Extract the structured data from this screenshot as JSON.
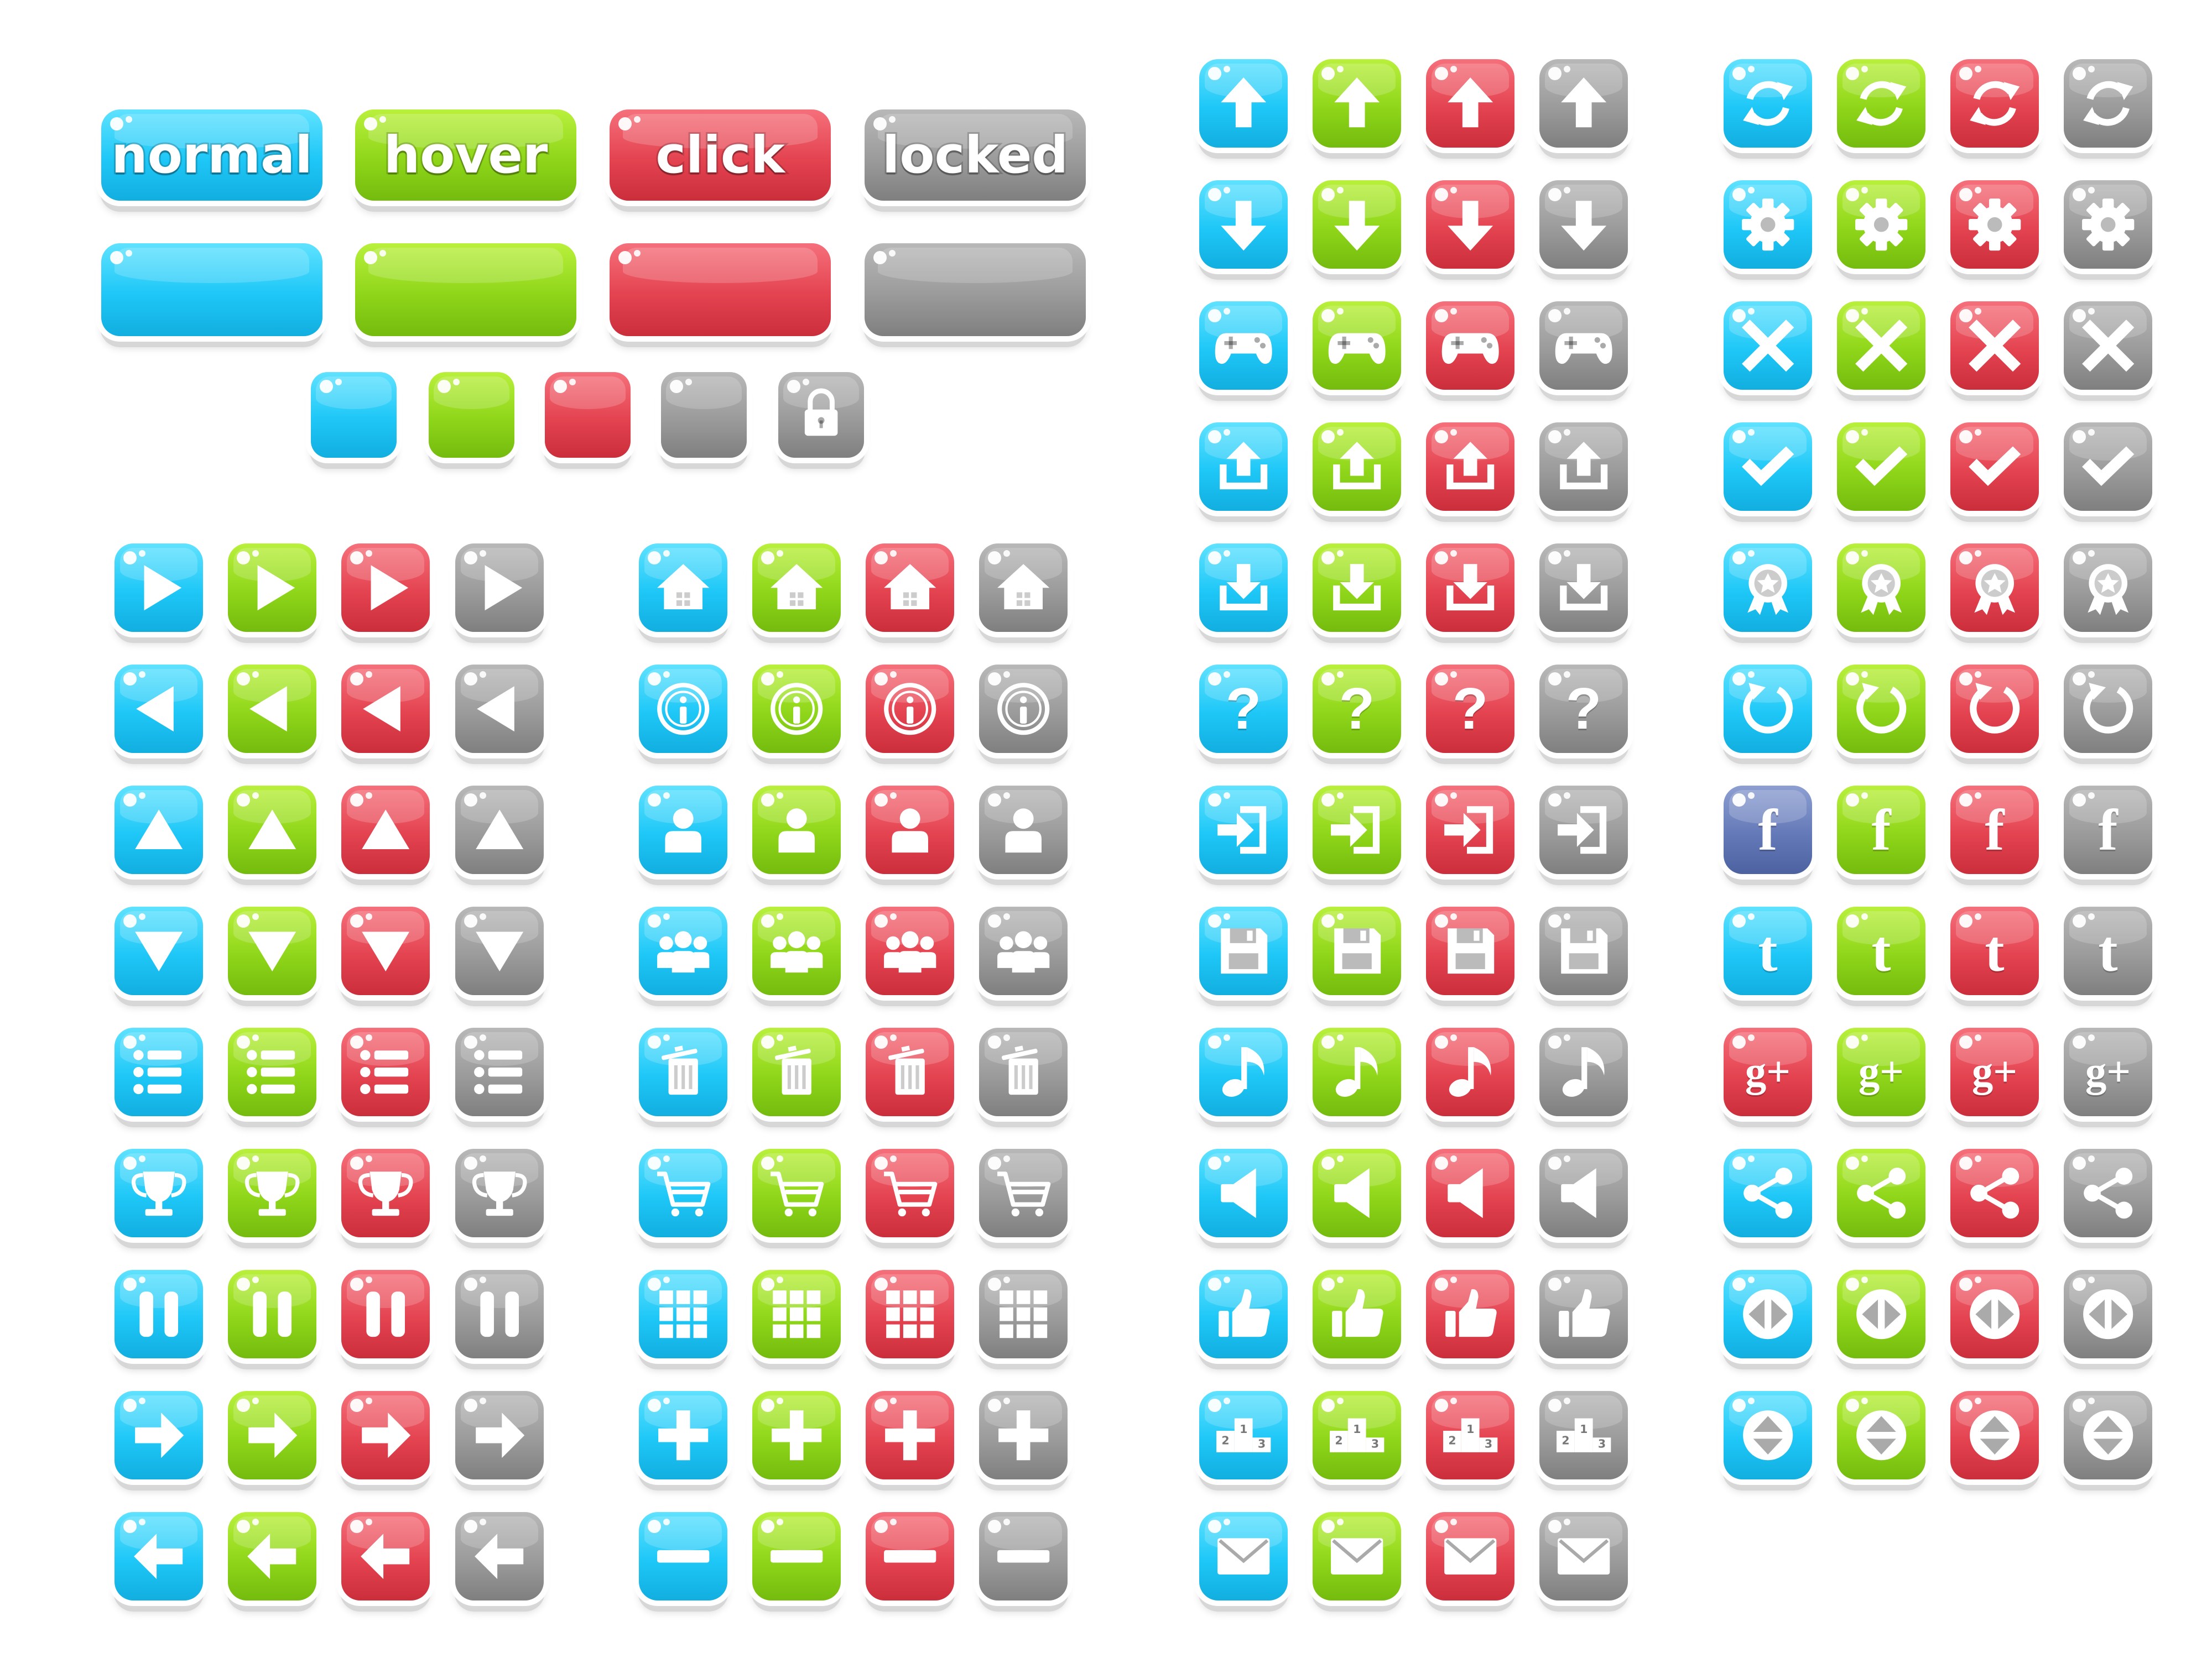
{
  "palette": {
    "blue": {
      "top": "#5fe2ff",
      "mid": "#1ec7f7",
      "bot": "#12aee0"
    },
    "green": {
      "top": "#b9f03c",
      "mid": "#8fd61a",
      "bot": "#74bb0e"
    },
    "red": {
      "top": "#f5707b",
      "mid": "#e44350",
      "bot": "#cb2e3b"
    },
    "gray": {
      "top": "#b8b8b8",
      "mid": "#9b9b9b",
      "bot": "#7f7f7f"
    },
    "fbblue": {
      "top": "#8d9fd1",
      "mid": "#6479b8",
      "bot": "#4d62a0"
    }
  },
  "state_colors": [
    "blue",
    "green",
    "red",
    "gray"
  ],
  "text_buttons": [
    {
      "label": "normal",
      "color": "blue"
    },
    {
      "label": "hover",
      "color": "green"
    },
    {
      "label": "click",
      "color": "red"
    },
    {
      "label": "locked",
      "color": "gray"
    }
  ],
  "blank_wide_buttons": [
    "blue",
    "green",
    "red",
    "gray"
  ],
  "small_squares": [
    {
      "color": "blue",
      "icon": ""
    },
    {
      "color": "green",
      "icon": ""
    },
    {
      "color": "red",
      "icon": ""
    },
    {
      "color": "gray",
      "icon": ""
    },
    {
      "color": "gray",
      "icon": "lock-icon"
    }
  ],
  "icon_sets": [
    [
      "play-right-icon",
      "play-left-icon",
      "triangle-up-icon",
      "triangle-down-icon",
      "list-icon",
      "trophy-icon",
      "pause-icon",
      "arrow-right-icon",
      "arrow-left-icon"
    ],
    [
      "home-icon",
      "info-icon",
      "user-icon",
      "group-icon",
      "trash-icon",
      "cart-icon",
      "grid-icon",
      "plus-icon",
      "minus-icon"
    ],
    [
      "arrow-up-icon",
      "arrow-down-icon",
      "gamepad-icon",
      "upload-icon",
      "download-icon",
      "question-icon",
      "login-icon",
      "save-icon",
      "music-icon",
      "volume-icon",
      "thumbs-up-icon",
      "podium-icon",
      "mail-icon"
    ],
    [
      "refresh-icon",
      "gear-icon",
      "close-icon",
      "check-icon",
      "award-icon",
      "restart-icon",
      "facebook-icon",
      "twitter-icon",
      "google-plus-icon",
      "share-icon",
      "horizontal-arrows-icon",
      "vertical-arrows-icon"
    ]
  ],
  "glyph_text": {
    "question": "?",
    "facebook": "f",
    "twitter": "t",
    "google_plus": "g+",
    "podium_first": "1",
    "podium_second": "2",
    "podium_third": "3"
  },
  "facebook_normal_color": "fbblue"
}
